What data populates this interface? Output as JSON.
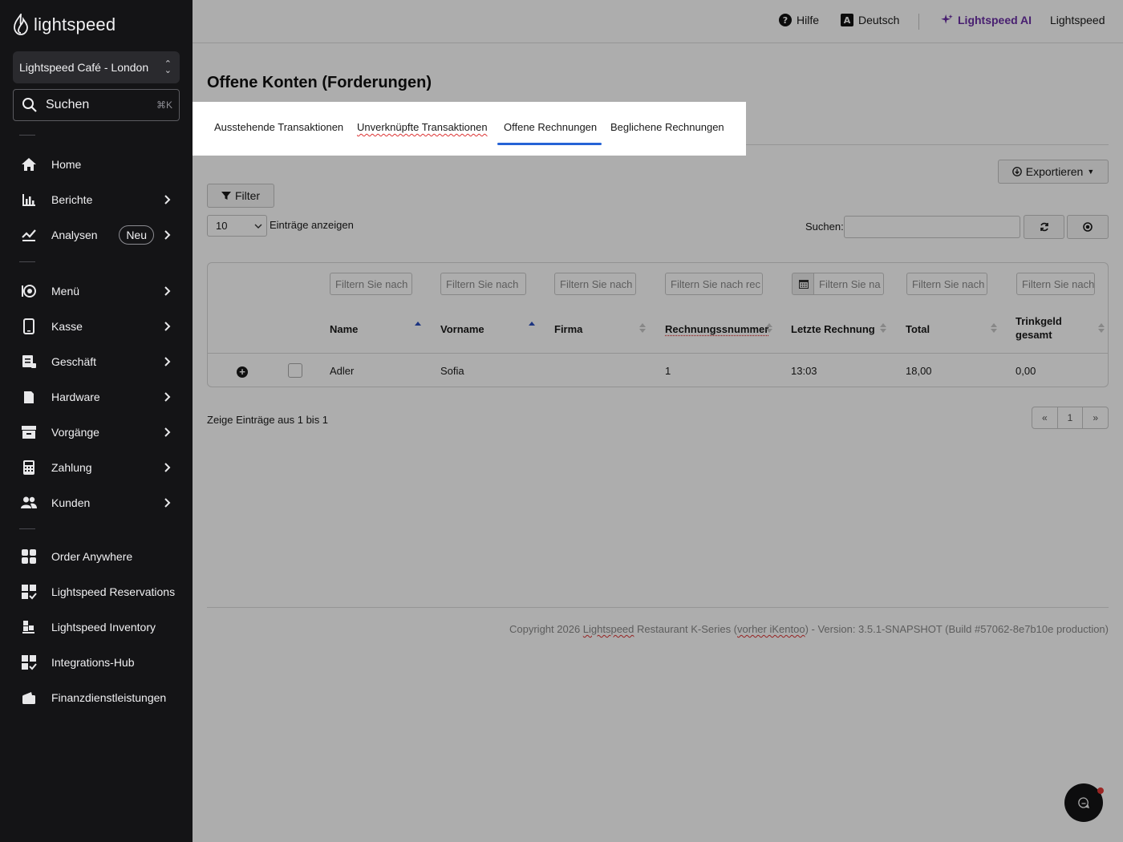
{
  "app": {
    "logo_text": "lightspeed"
  },
  "sidebar": {
    "location": "Lightspeed Café - London",
    "search_label": "Suchen",
    "search_shortcut": "⌘K",
    "items": [
      {
        "label": "Home"
      },
      {
        "label": "Berichte"
      },
      {
        "label": "Analysen",
        "badge": "Neu"
      },
      {
        "label": "Menü"
      },
      {
        "label": "Kasse"
      },
      {
        "label": "Geschäft"
      },
      {
        "label": "Hardware"
      },
      {
        "label": "Vorgänge"
      },
      {
        "label": "Zahlung"
      },
      {
        "label": "Kunden"
      },
      {
        "label": "Order Anywhere"
      },
      {
        "label": "Lightspeed Reservations"
      },
      {
        "label": "Lightspeed Inventory"
      },
      {
        "label": "Integrations-Hub"
      },
      {
        "label": "Finanzdienstleistungen"
      }
    ]
  },
  "topbar": {
    "help": "Hilfe",
    "language": "Deutsch",
    "ai": "Lightspeed AI",
    "account": "Lightspeed"
  },
  "page": {
    "title": "Offene Konten (Forderungen)",
    "tabs": [
      {
        "label": "Ausstehende Transaktionen"
      },
      {
        "label": "Unverknüpfte Transaktionen"
      },
      {
        "label": "Offene Rechnungen",
        "active": true
      },
      {
        "label": "Beglichene Rechnungen"
      }
    ],
    "export_label": "Exportieren",
    "filter_label": "Filter",
    "page_size": "10",
    "page_size_label": "Einträge anzeigen",
    "search_label": "Suchen:"
  },
  "table": {
    "filter_placeholders": [
      "Filtern Sie nach",
      "Filtern Sie nach",
      "Filtern Sie nach",
      "Filtern Sie nach rec",
      "Filtern Sie na",
      "Filtern Sie nach",
      "Filtern Sie nach"
    ],
    "columns": {
      "name": "Name",
      "vorname": "Vorname",
      "firma": "Firma",
      "rechnungsnummer": "Rechnungssnummer",
      "letzte": "Letzte Rechnung",
      "total": "Total",
      "trinkgeld_1": "Trinkgeld",
      "trinkgeld_2": "gesamt"
    },
    "rows": [
      {
        "name": "Adler",
        "vorname": "Sofia",
        "firma": "",
        "rechnungsnummer": "1",
        "letzte": "13:03",
        "total": "18,00",
        "trinkgeld": "0,00"
      }
    ]
  },
  "footer": {
    "info": "Zeige Einträge aus 1 bis 1",
    "pager": {
      "prev": "«",
      "page": "1",
      "next": "»"
    },
    "copyright_pre": "Copyright 2026 ",
    "copyright_link1": "Lightspeed",
    "copyright_mid": " Restaurant K-Series (",
    "copyright_link2": "vorher iKentoo",
    "copyright_post": ") - Version: 3.5.1-SNAPSHOT (Build #57062-8e7b10e production)"
  },
  "colors": {
    "accent": "#2563d6",
    "ai": "#6b2fa5",
    "sidebar": "#141416"
  }
}
